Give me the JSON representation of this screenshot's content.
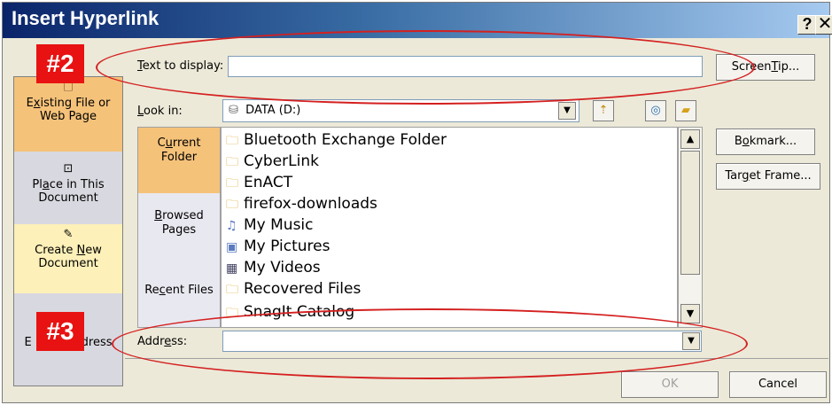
{
  "window": {
    "title": "Insert Hyperlink",
    "help_glyph": "?",
    "close_glyph": "✕"
  },
  "text_to_display": {
    "label_underlined": "T",
    "label_rest": "ext to display:",
    "value": ""
  },
  "screentip_label_a": "Screen",
  "screentip_label_u": "T",
  "screentip_label_b": "ip...",
  "link_to": {
    "existing": {
      "line1_u": "x",
      "line1_a": "E",
      "line1_b": "isting File or",
      "line2": "Web Page"
    },
    "place": {
      "line1_a": "Pl",
      "line1_u": "a",
      "line1_b": "ce in This",
      "line2": "Document"
    },
    "create": {
      "line1_a": "Create ",
      "line1_u": "N",
      "line1_b": "ew",
      "line2": "Document"
    },
    "email": {
      "line1_a": "E",
      "line1_b": "dress"
    }
  },
  "look_in": {
    "label_u": "L",
    "label_rest": "ook in:",
    "value": "DATA (D:)"
  },
  "lookin_bar": {
    "current": {
      "line1_a": "C",
      "line1_u": "u",
      "line1_b": "rrent",
      "line2": "Folder"
    },
    "browsed": {
      "line1_u": "B",
      "line1_rest": "rowsed",
      "line2": "Pages"
    },
    "recent": {
      "line1_a": "Re",
      "line1_u": "c",
      "line1_b": "ent Files"
    }
  },
  "files": [
    "Bluetooth Exchange Folder",
    "CyberLink",
    "EnACT",
    "firefox-downloads",
    "My Music",
    "My Pictures",
    "My Videos",
    "Recovered Files",
    "SnagIt Catalog"
  ],
  "buttons": {
    "bookmark_u": "o",
    "bookmark_a": "B",
    "bookmark_b": "kmark...",
    "target_a": "Tar",
    "target_u": "g",
    "target_b": "et Frame...",
    "ok": "OK",
    "cancel": "Cancel"
  },
  "address": {
    "label_a": "Addr",
    "label_u": "e",
    "label_b": "ss:",
    "value": ""
  },
  "annotations": {
    "badge2": "#2",
    "badge3": "#3"
  },
  "colors": {
    "annotation_red": "#e81212",
    "ellipse_red": "#d42020",
    "selected_tab": "#f5c27a"
  }
}
